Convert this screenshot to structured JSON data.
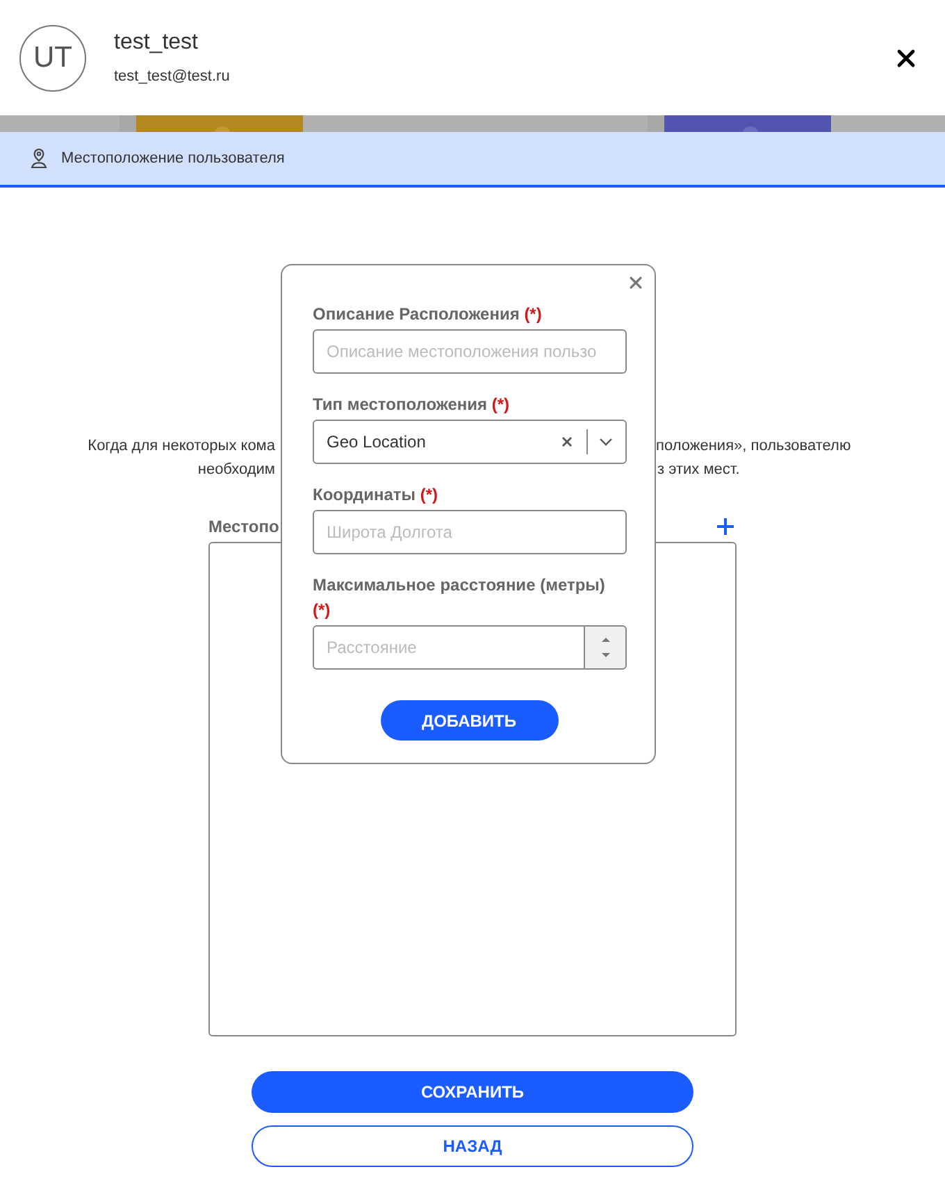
{
  "user": {
    "initials": "UT",
    "name": "test_test",
    "email": "test_test@test.ru"
  },
  "tabs": [
    {
      "label": "Местоположение пользователя",
      "selected": true
    }
  ],
  "description": [
    {
      "left": "Когда для некоторых кома",
      "right": "положения», пользователю"
    },
    {
      "left": "необходим",
      "right": "з этих мест."
    }
  ],
  "locations": {
    "label": "Местопо"
  },
  "dialog": {
    "fields": [
      {
        "kind": "text",
        "label": "Описание Расположения",
        "required": "(*)",
        "placeholder": "Описание местоположения пользо"
      },
      {
        "kind": "select",
        "label": "Тип местоположения",
        "required": "(*)",
        "value": "Geo Location"
      },
      {
        "kind": "text",
        "label": "Координаты",
        "required": "(*)",
        "placeholder": "Широта Долгота"
      },
      {
        "kind": "number",
        "label": "Максимальное расстояние (метры)",
        "required": "(*)",
        "placeholder": "Расстояние"
      }
    ],
    "button": "ДОБАВИТЬ"
  },
  "buttons": [
    {
      "label": "СОХРАНИТЬ",
      "kind": "primary"
    },
    {
      "label": "НАЗАД",
      "kind": "outline"
    }
  ]
}
